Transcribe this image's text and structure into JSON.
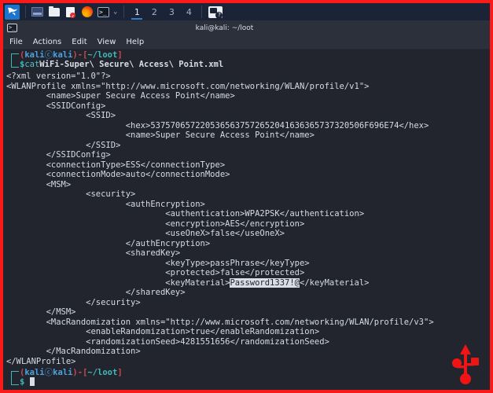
{
  "taskbar": {
    "items": [
      {
        "name": "kali-menu-icon",
        "label": "Kali",
        "active": true
      },
      {
        "name": "show-desktop-icon",
        "label": "Show Desktop"
      },
      {
        "name": "file-manager-icon",
        "label": "File Manager"
      },
      {
        "name": "text-editor-icon",
        "label": "Text Editor"
      },
      {
        "name": "firefox-icon",
        "label": "Firefox"
      },
      {
        "name": "terminal-icon",
        "label": "Terminal"
      }
    ],
    "dropdown_glyph": "⌄",
    "workspaces": [
      "1",
      "2",
      "3",
      "4"
    ],
    "current_workspace": "1",
    "tray_icon": "help-terminal-icon"
  },
  "window": {
    "title": "kali@kali: ~/loot",
    "icon": "terminal-icon",
    "menu": [
      "File",
      "Actions",
      "Edit",
      "View",
      "Help"
    ]
  },
  "terminal": {
    "prompt": {
      "open_paren": "(",
      "user": "kali",
      "at": "ⓒ",
      "host": "kali",
      "close_paren": ")-[",
      "path": "~/loot",
      "close_bracket": "]",
      "dollar": "$"
    },
    "command_name": "cat",
    "command_args": "WiFi-Super\\ Secure\\ Access\\ Point.xml",
    "output": [
      "<?xml version=\"1.0\"?>",
      "<WLANProfile xmlns=\"http://www.microsoft.com/networking/WLAN/profile/v1\">",
      "        <name>Super Secure Access Point</name>",
      "        <SSIDConfig>",
      "                <SSID>",
      "                        <hex>5375706572205365637572652041636365737320506F696E74</hex>",
      "                        <name>Super Secure Access Point</name>",
      "                </SSID>",
      "        </SSIDConfig>",
      "        <connectionType>ESS</connectionType>",
      "        <connectionMode>auto</connectionMode>",
      "        <MSM>",
      "                <security>",
      "                        <authEncryption>",
      "                                <authentication>WPA2PSK</authentication>",
      "                                <encryption>AES</encryption>",
      "                                <useOneX>false</useOneX>",
      "                        </authEncryption>",
      "                        <sharedKey>",
      "                                <keyType>passPhrase</keyType>",
      "                                <protected>false</protected>"
    ],
    "key_material_line": {
      "prefix": "                                <keyMaterial>",
      "selected": "Password1337!@",
      "suffix": "</keyMaterial>"
    },
    "output_tail": [
      "                        </sharedKey>",
      "                </security>",
      "        </MSM>",
      "        <MacRandomization xmlns=\"http://www.microsoft.com/networking/WLAN/profile/v3\">",
      "                <enableRandomization>true</enableRandomization>",
      "                <randomizationSeed>4281551656</randomizationSeed>",
      "        </MacRandomization>",
      "</WLANProfile>"
    ],
    "cursor": "█"
  },
  "watermark": {
    "name": "usb-logo",
    "color": "#f01414"
  },
  "colors": {
    "border": "#fb1a1a",
    "terminal_bg": "#22252e",
    "taskbar_bg": "#1b2436",
    "titlebar_bg": "#2b303b",
    "prompt_path": "#3fb9b9",
    "prompt_user": "#4aa3e0",
    "prompt_bracket": "#c94a4a",
    "selection": "#d9dde5"
  }
}
